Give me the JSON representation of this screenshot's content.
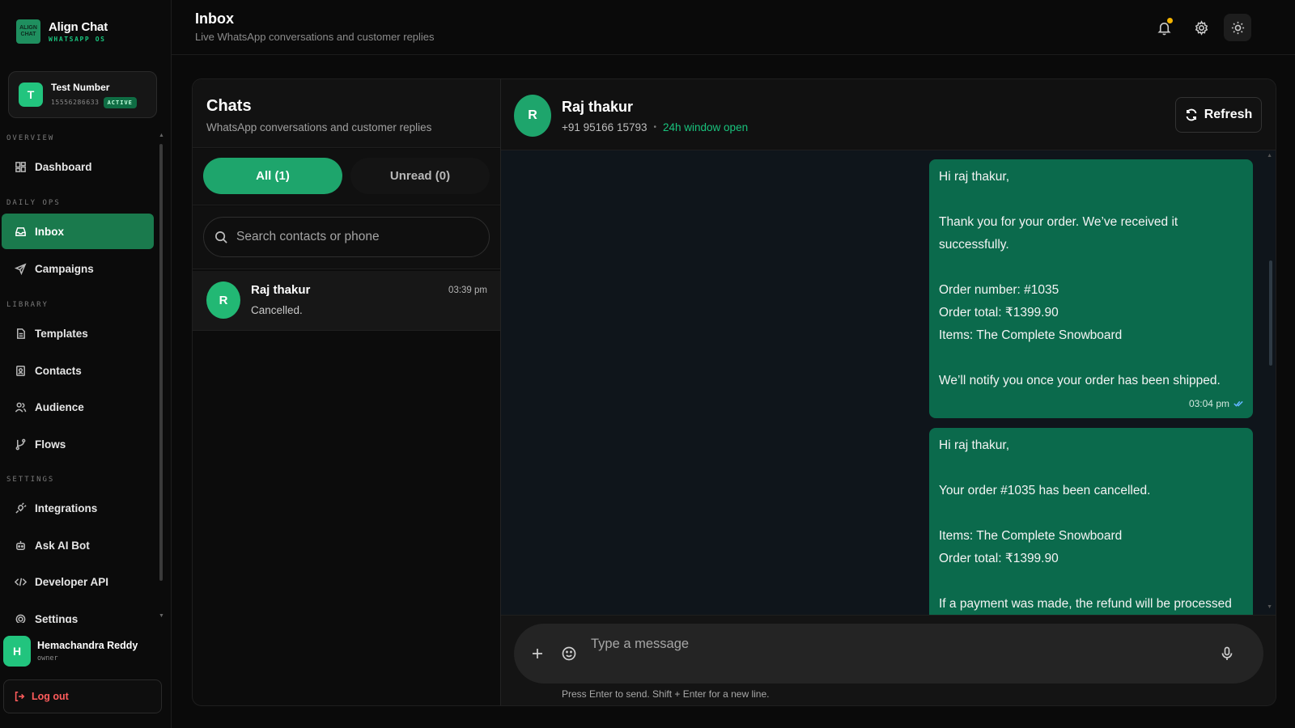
{
  "brand": {
    "logo_text": "ALIGN CHAT",
    "name": "Align Chat",
    "sub": "WHATSAPP OS"
  },
  "number_card": {
    "avatar": "T",
    "name": "Test Number",
    "phone": "15556286633",
    "badge": "ACTIVE"
  },
  "sections": {
    "overview": "OVERVIEW",
    "daily_ops": "DAILY OPS",
    "library": "LIBRARY",
    "settings": "SETTINGS"
  },
  "nav": {
    "dashboard": "Dashboard",
    "inbox": "Inbox",
    "campaigns": "Campaigns",
    "templates": "Templates",
    "contacts": "Contacts",
    "audience": "Audience",
    "flows": "Flows",
    "integrations": "Integrations",
    "ask_ai_bot": "Ask AI Bot",
    "developer_api": "Developer API",
    "settings": "Settings"
  },
  "user": {
    "avatar": "H",
    "name": "Hemachandra Reddy",
    "role": "owner"
  },
  "logout_label": "Log out",
  "header": {
    "title": "Inbox",
    "subtitle": "Live WhatsApp conversations and customer replies"
  },
  "chats": {
    "title": "Chats",
    "subtitle": "WhatsApp conversations and customer replies",
    "tab_all": "All (1)",
    "tab_unread": "Unread (0)",
    "search_placeholder": "Search contacts or phone",
    "items": [
      {
        "avatar": "R",
        "name": "Raj thakur",
        "preview": "Cancelled.",
        "time": "03:39 pm"
      }
    ]
  },
  "conversation": {
    "avatar": "R",
    "name": "Raj thakur",
    "phone": "+91 95166 15793",
    "window_status": "24h window open",
    "refresh_label": "Refresh",
    "messages": [
      {
        "lines": [
          "Hi raj thakur,",
          "",
          "Thank you for your order. We’ve received it successfully.",
          "",
          "Order number: #1035",
          "Order total: ₹1399.90",
          "Items: The Complete Snowboard",
          "",
          "We’ll notify you once your order has been shipped."
        ],
        "time": "03:04 pm"
      },
      {
        "lines": [
          "Hi raj thakur,",
          "",
          "Your order #1035 has been cancelled.",
          "",
          "Items: The Complete Snowboard",
          "Order total: ₹1399.90",
          "",
          "If a payment was made, the refund will be processed"
        ]
      }
    ],
    "composer_placeholder": "Type a message",
    "composer_hint": "Press Enter to send. Shift + Enter for a new line."
  },
  "colors": {
    "accent": "#1ea56c",
    "bubble": "#0b6a4c",
    "status_green": "#19c37d",
    "danger": "#ff5c5c",
    "notif": "#f5b400"
  }
}
